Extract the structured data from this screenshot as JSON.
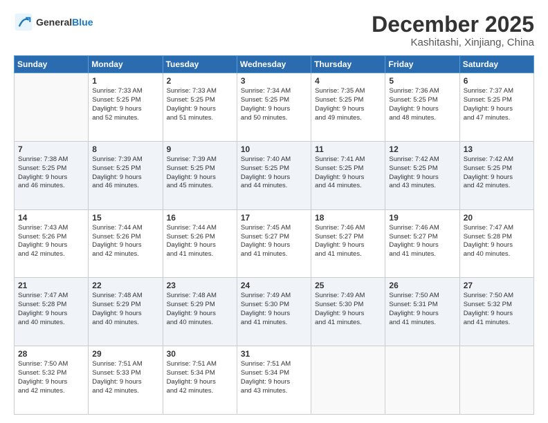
{
  "logo": {
    "line1": "General",
    "line2": "Blue"
  },
  "header": {
    "month": "December 2025",
    "location": "Kashitashi, Xinjiang, China"
  },
  "weekdays": [
    "Sunday",
    "Monday",
    "Tuesday",
    "Wednesday",
    "Thursday",
    "Friday",
    "Saturday"
  ],
  "rows": [
    [
      {
        "day": "",
        "info": ""
      },
      {
        "day": "1",
        "info": "Sunrise: 7:33 AM\nSunset: 5:25 PM\nDaylight: 9 hours\nand 52 minutes."
      },
      {
        "day": "2",
        "info": "Sunrise: 7:33 AM\nSunset: 5:25 PM\nDaylight: 9 hours\nand 51 minutes."
      },
      {
        "day": "3",
        "info": "Sunrise: 7:34 AM\nSunset: 5:25 PM\nDaylight: 9 hours\nand 50 minutes."
      },
      {
        "day": "4",
        "info": "Sunrise: 7:35 AM\nSunset: 5:25 PM\nDaylight: 9 hours\nand 49 minutes."
      },
      {
        "day": "5",
        "info": "Sunrise: 7:36 AM\nSunset: 5:25 PM\nDaylight: 9 hours\nand 48 minutes."
      },
      {
        "day": "6",
        "info": "Sunrise: 7:37 AM\nSunset: 5:25 PM\nDaylight: 9 hours\nand 47 minutes."
      }
    ],
    [
      {
        "day": "7",
        "info": "Sunrise: 7:38 AM\nSunset: 5:25 PM\nDaylight: 9 hours\nand 46 minutes."
      },
      {
        "day": "8",
        "info": "Sunrise: 7:39 AM\nSunset: 5:25 PM\nDaylight: 9 hours\nand 46 minutes."
      },
      {
        "day": "9",
        "info": "Sunrise: 7:39 AM\nSunset: 5:25 PM\nDaylight: 9 hours\nand 45 minutes."
      },
      {
        "day": "10",
        "info": "Sunrise: 7:40 AM\nSunset: 5:25 PM\nDaylight: 9 hours\nand 44 minutes."
      },
      {
        "day": "11",
        "info": "Sunrise: 7:41 AM\nSunset: 5:25 PM\nDaylight: 9 hours\nand 44 minutes."
      },
      {
        "day": "12",
        "info": "Sunrise: 7:42 AM\nSunset: 5:25 PM\nDaylight: 9 hours\nand 43 minutes."
      },
      {
        "day": "13",
        "info": "Sunrise: 7:42 AM\nSunset: 5:25 PM\nDaylight: 9 hours\nand 42 minutes."
      }
    ],
    [
      {
        "day": "14",
        "info": "Sunrise: 7:43 AM\nSunset: 5:26 PM\nDaylight: 9 hours\nand 42 minutes."
      },
      {
        "day": "15",
        "info": "Sunrise: 7:44 AM\nSunset: 5:26 PM\nDaylight: 9 hours\nand 42 minutes."
      },
      {
        "day": "16",
        "info": "Sunrise: 7:44 AM\nSunset: 5:26 PM\nDaylight: 9 hours\nand 41 minutes."
      },
      {
        "day": "17",
        "info": "Sunrise: 7:45 AM\nSunset: 5:27 PM\nDaylight: 9 hours\nand 41 minutes."
      },
      {
        "day": "18",
        "info": "Sunrise: 7:46 AM\nSunset: 5:27 PM\nDaylight: 9 hours\nand 41 minutes."
      },
      {
        "day": "19",
        "info": "Sunrise: 7:46 AM\nSunset: 5:27 PM\nDaylight: 9 hours\nand 41 minutes."
      },
      {
        "day": "20",
        "info": "Sunrise: 7:47 AM\nSunset: 5:28 PM\nDaylight: 9 hours\nand 40 minutes."
      }
    ],
    [
      {
        "day": "21",
        "info": "Sunrise: 7:47 AM\nSunset: 5:28 PM\nDaylight: 9 hours\nand 40 minutes."
      },
      {
        "day": "22",
        "info": "Sunrise: 7:48 AM\nSunset: 5:29 PM\nDaylight: 9 hours\nand 40 minutes."
      },
      {
        "day": "23",
        "info": "Sunrise: 7:48 AM\nSunset: 5:29 PM\nDaylight: 9 hours\nand 40 minutes."
      },
      {
        "day": "24",
        "info": "Sunrise: 7:49 AM\nSunset: 5:30 PM\nDaylight: 9 hours\nand 41 minutes."
      },
      {
        "day": "25",
        "info": "Sunrise: 7:49 AM\nSunset: 5:30 PM\nDaylight: 9 hours\nand 41 minutes."
      },
      {
        "day": "26",
        "info": "Sunrise: 7:50 AM\nSunset: 5:31 PM\nDaylight: 9 hours\nand 41 minutes."
      },
      {
        "day": "27",
        "info": "Sunrise: 7:50 AM\nSunset: 5:32 PM\nDaylight: 9 hours\nand 41 minutes."
      }
    ],
    [
      {
        "day": "28",
        "info": "Sunrise: 7:50 AM\nSunset: 5:32 PM\nDaylight: 9 hours\nand 42 minutes."
      },
      {
        "day": "29",
        "info": "Sunrise: 7:51 AM\nSunset: 5:33 PM\nDaylight: 9 hours\nand 42 minutes."
      },
      {
        "day": "30",
        "info": "Sunrise: 7:51 AM\nSunset: 5:34 PM\nDaylight: 9 hours\nand 42 minutes."
      },
      {
        "day": "31",
        "info": "Sunrise: 7:51 AM\nSunset: 5:34 PM\nDaylight: 9 hours\nand 43 minutes."
      },
      {
        "day": "",
        "info": ""
      },
      {
        "day": "",
        "info": ""
      },
      {
        "day": "",
        "info": ""
      }
    ]
  ]
}
